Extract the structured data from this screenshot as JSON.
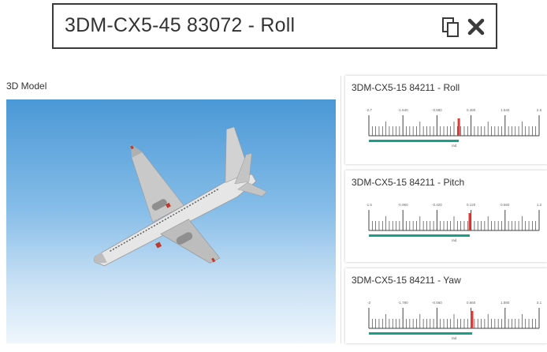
{
  "top_widget": {
    "title": "3DM-CX5-45 83072 - Roll"
  },
  "model_panel": {
    "title": "3D Model"
  },
  "gauges": [
    {
      "title": "3DM-CX5-15 84211 - Roll",
      "ticks": [
        "-2.7",
        "-1.640",
        "-0.580",
        "0.480",
        "1.540",
        "2.6"
      ],
      "unit": "rad",
      "min": -2.7,
      "max": 2.6,
      "value": 0.1,
      "fill_start": -2.7
    },
    {
      "title": "3DM-CX5-15 84211 - Pitch",
      "ticks": [
        "-1.5",
        "-0.960",
        "-0.420",
        "0.120",
        "0.660",
        "1.2"
      ],
      "unit": "rad",
      "min": -1.5,
      "max": 1.2,
      "value": 0.1,
      "fill_start": -1.5
    },
    {
      "title": "3DM-CX5-15 84211 - Yaw",
      "ticks": [
        "-3",
        "-1.780",
        "-0.560",
        "0.660",
        "1.880",
        "3.1"
      ],
      "unit": "rad",
      "min": -3.0,
      "max": 3.1,
      "value": 0.7,
      "fill_start": -3.0
    }
  ],
  "colors": {
    "needle": "#e53935",
    "fill_bar": "#16a085",
    "sky_top": "#4a98d6",
    "sky_bottom": "#eef6fc"
  },
  "icons": [
    "copy-icon",
    "close-icon"
  ]
}
